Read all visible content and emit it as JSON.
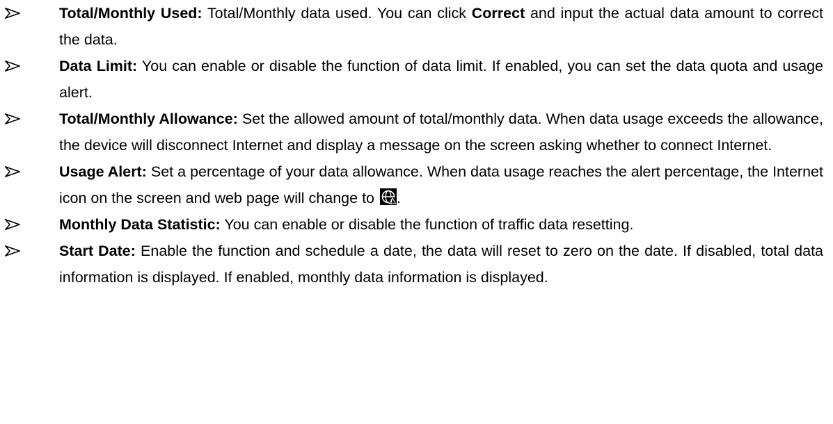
{
  "items": [
    {
      "term": "Total/Monthly Used:",
      "text_before": " Total/Monthly data used. You can click ",
      "bold_word": "Correct",
      "text_after": " and input the actual data amount to correct the data."
    },
    {
      "term": "Data Limit:",
      "text": " You can enable or disable the function of data limit. If enabled, you can set the data quota and usage alert."
    },
    {
      "term": "Total/Monthly Allowance:",
      "text": " Set the allowed amount of total/monthly data. When data usage exceeds the allowance, the device will disconnect Internet and display a message on the screen asking whether to connect Internet."
    },
    {
      "term": "Usage Alert:",
      "text_before": " Set a percentage of your data allowance. When data usage reaches the alert percentage, the Internet icon on the screen and web page will change to ",
      "icon": "data-alert-globe-icon",
      "text_after": "."
    },
    {
      "term": "Monthly Data Statistic:",
      "text": " You can enable or disable the function of traffic data resetting."
    },
    {
      "term": "Start Date:",
      "text": " Enable the function and schedule a date, the data will reset to zero on the date. If disabled, total data information is displayed. If enabled, monthly data information is displayed."
    }
  ],
  "colors": {
    "text": "#000000",
    "background": "#ffffff"
  }
}
